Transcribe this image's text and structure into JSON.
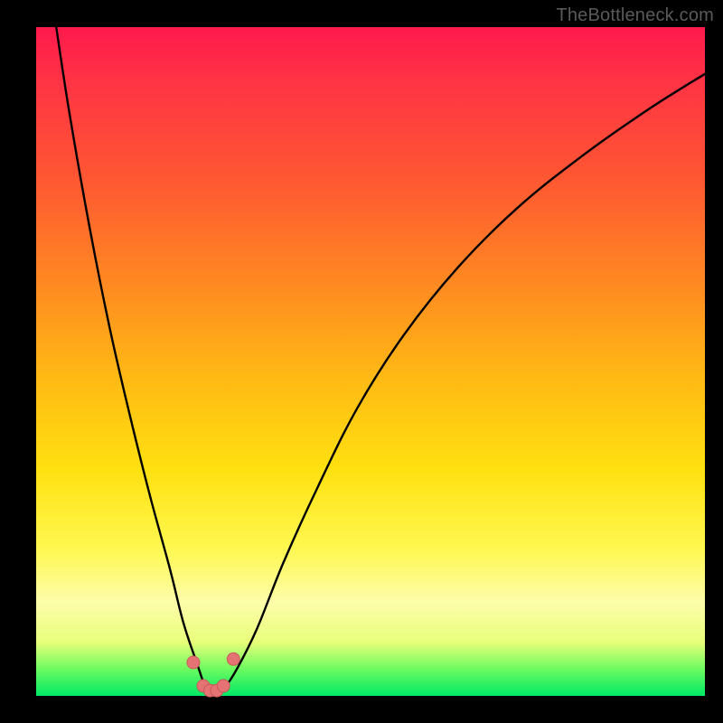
{
  "watermark": "TheBottleneck.com",
  "colors": {
    "frame": "#000000",
    "curve": "#000000",
    "marker_fill": "#e57373",
    "marker_stroke": "#c95a5a",
    "gradient_stops": [
      "#ff1a4d",
      "#ff3344",
      "#ff5533",
      "#ff8822",
      "#ffb814",
      "#ffe010",
      "#fff850",
      "#fdfdaa",
      "#e8ff7a",
      "#6cfb60",
      "#00e865"
    ]
  },
  "chart_data": {
    "type": "line",
    "title": "",
    "xlabel": "",
    "ylabel": "",
    "xlim": [
      0,
      100
    ],
    "ylim": [
      0,
      100
    ],
    "grid": false,
    "note": "Bottleneck-style V curve; y is percentage mismatch (0=green bottom, 100=red top). Values eyeballed from plot.",
    "series": [
      {
        "name": "bottleneck-curve",
        "x": [
          3,
          5,
          8,
          11,
          14,
          17,
          20,
          22,
          24,
          25.5,
          27,
          28,
          30,
          33,
          37,
          42,
          48,
          55,
          63,
          72,
          82,
          92,
          100
        ],
        "y": [
          100,
          87,
          70,
          55,
          42,
          30,
          19,
          11,
          5,
          1,
          0.5,
          1,
          4,
          10,
          20,
          31,
          43,
          54,
          64,
          73,
          81,
          88,
          93
        ]
      }
    ],
    "markers": {
      "name": "highlight-points",
      "x": [
        23.5,
        25.0,
        26.0,
        27.0,
        28.0,
        29.5
      ],
      "y": [
        5.0,
        1.5,
        0.8,
        0.8,
        1.5,
        5.5
      ]
    }
  }
}
